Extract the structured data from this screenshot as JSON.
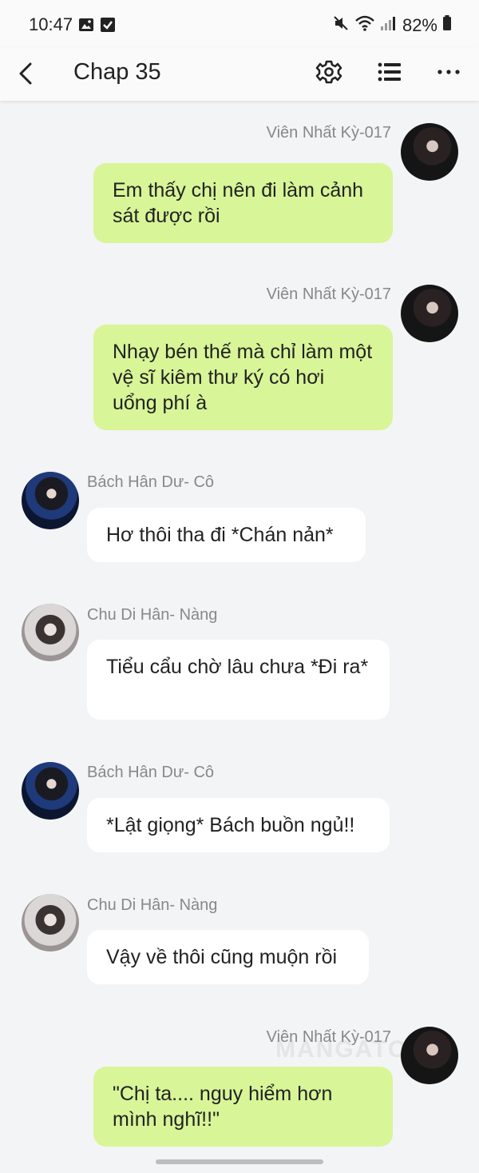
{
  "status_bar": {
    "time": "10:47",
    "battery": "82%"
  },
  "header": {
    "title": "Chap 35"
  },
  "messages": [
    {
      "sender": "Viên Nhất Kỳ-017",
      "side": "right",
      "text": "Em thấy chị nên đi làm cảnh sát được rồi"
    },
    {
      "sender": "Viên Nhất Kỳ-017",
      "side": "right",
      "text": "Nhạy bén thế mà chỉ làm một vệ sĩ kiêm thư ký có hơi uổng phí à"
    },
    {
      "sender": "Bách Hân Dư- Cô",
      "side": "left",
      "text": "Hơ thôi tha đi *Chán nản*"
    },
    {
      "sender": "Chu Di Hân- Nàng",
      "side": "left",
      "text": "Tiểu cẩu chờ lâu chưa *Đi ra*"
    },
    {
      "sender": "Bách Hân Dư- Cô",
      "side": "left",
      "text": "*Lật giọng* Bách buồn ngủ!!"
    },
    {
      "sender": "Chu Di Hân- Nàng",
      "side": "left",
      "text": "Vậy về thôi cũng muộn rồi"
    },
    {
      "sender": "Viên Nhất Kỳ-017",
      "side": "right",
      "text": "\"Chị ta.... nguy hiểm hơn mình nghĩ!!\""
    }
  ],
  "watermark": "MANGATOON",
  "colors": {
    "right_bubble": "#d8f598",
    "left_bubble": "#ffffff",
    "background": "#f3f4f6"
  }
}
